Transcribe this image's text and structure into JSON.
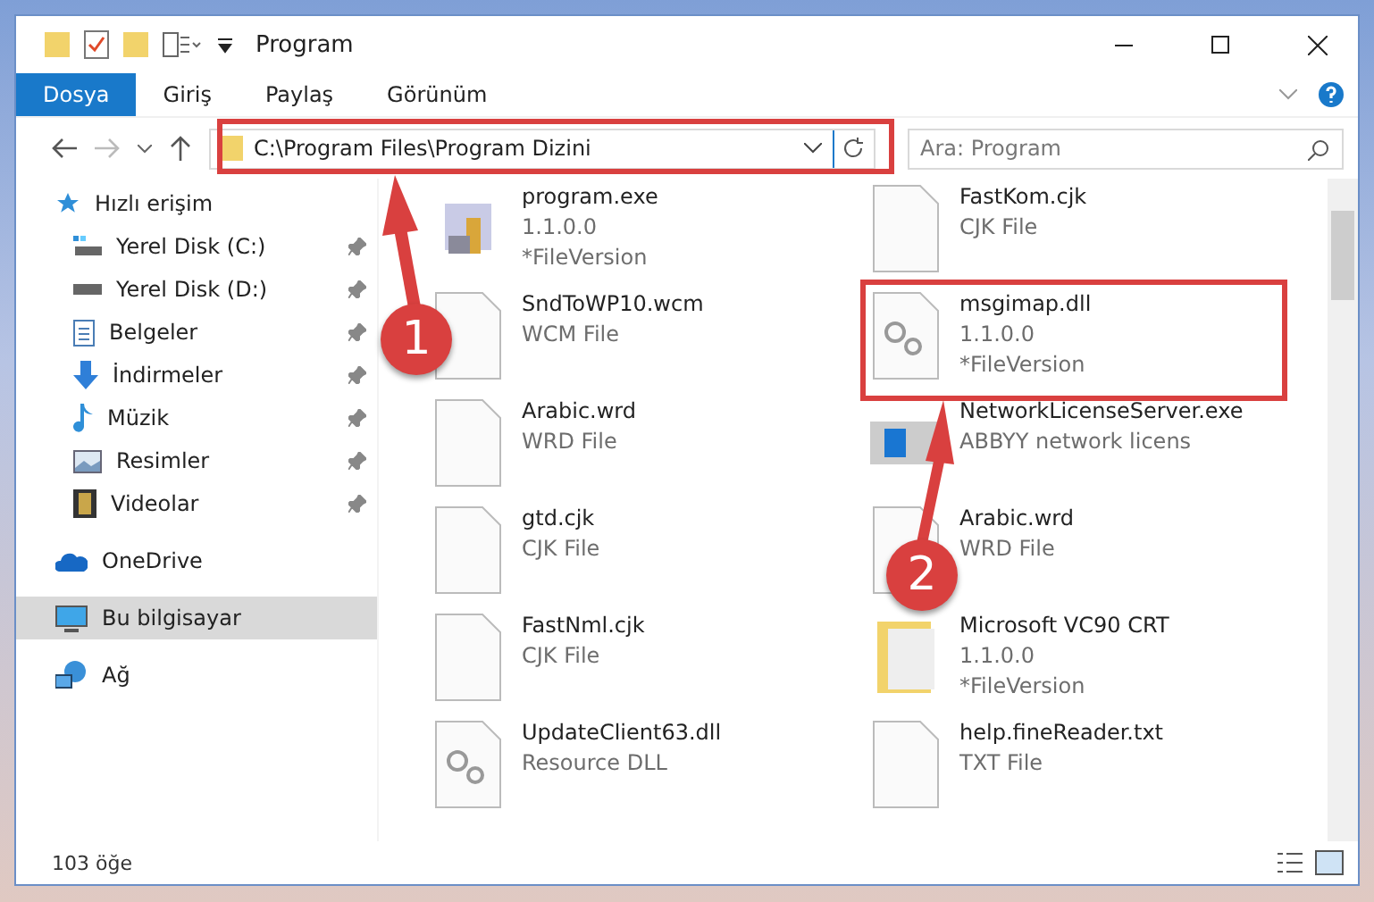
{
  "window": {
    "title": "Program"
  },
  "ribbon_tabs": [
    {
      "label": "Dosya",
      "selected": true
    },
    {
      "label": "Giriş",
      "selected": false
    },
    {
      "label": "Paylaş",
      "selected": false
    },
    {
      "label": "Görünüm",
      "selected": false
    }
  ],
  "address": {
    "path": "C:\\Program Files\\Program Dizini"
  },
  "search": {
    "placeholder": "Ara: Program"
  },
  "sidebar": {
    "items": [
      {
        "label": "Hızlı erişim",
        "pinned": false,
        "selected": false,
        "children": [
          {
            "label": "Yerel Disk (C:)",
            "pinned": true,
            "selected": false
          },
          {
            "label": "Yerel Disk (D:)",
            "pinned": true,
            "selected": false
          },
          {
            "label": "Belgeler",
            "pinned": true,
            "selected": false
          },
          {
            "label": "İndirmeler",
            "pinned": true,
            "selected": false
          },
          {
            "label": "Müzik",
            "pinned": true,
            "selected": false
          },
          {
            "label": "Resimler",
            "pinned": true,
            "selected": false
          },
          {
            "label": "Videolar",
            "pinned": true,
            "selected": false
          }
        ]
      },
      {
        "label": "OneDrive",
        "pinned": false,
        "selected": false
      },
      {
        "label": "Bu bilgisayar",
        "pinned": false,
        "selected": true
      },
      {
        "label": "Ağ",
        "pinned": false,
        "selected": false
      }
    ]
  },
  "files": [
    {
      "kind": "exe",
      "lines": [
        "program.exe",
        "1.1.0.0",
        "*FileVersion"
      ]
    },
    {
      "kind": "doc",
      "lines": [
        "FastKom.cjk",
        "CJK File"
      ]
    },
    {
      "kind": "doc",
      "lines": [
        "SndToWP10.wcm",
        "WCM File"
      ]
    },
    {
      "kind": "dll",
      "lines": [
        "msgimap.dll",
        "1.1.0.0",
        "*FileVersion"
      ]
    },
    {
      "kind": "doc",
      "lines": [
        "Arabic.wrd",
        "WRD File"
      ]
    },
    {
      "kind": "app",
      "lines": [
        "NetworkLicenseServer.exe",
        "ABBYY network licens"
      ]
    },
    {
      "kind": "doc",
      "lines": [
        "gtd.cjk",
        "CJK File"
      ]
    },
    {
      "kind": "doc",
      "lines": [
        "Arabic.wrd",
        "WRD File"
      ]
    },
    {
      "kind": "doc",
      "lines": [
        "FastNml.cjk",
        "CJK File"
      ]
    },
    {
      "kind": "folder",
      "lines": [
        "Microsoft VC90 CRT",
        "1.1.0.0",
        "*FileVersion"
      ]
    },
    {
      "kind": "dll",
      "lines": [
        "UpdateClient63.dll",
        "Resource DLL"
      ]
    },
    {
      "kind": "doc",
      "lines": [
        "help.fineReader.txt",
        "TXT File"
      ]
    }
  ],
  "status_bar": {
    "count": "103 öğe"
  },
  "annotations": [
    {
      "label": "1"
    },
    {
      "label": "2"
    }
  ]
}
